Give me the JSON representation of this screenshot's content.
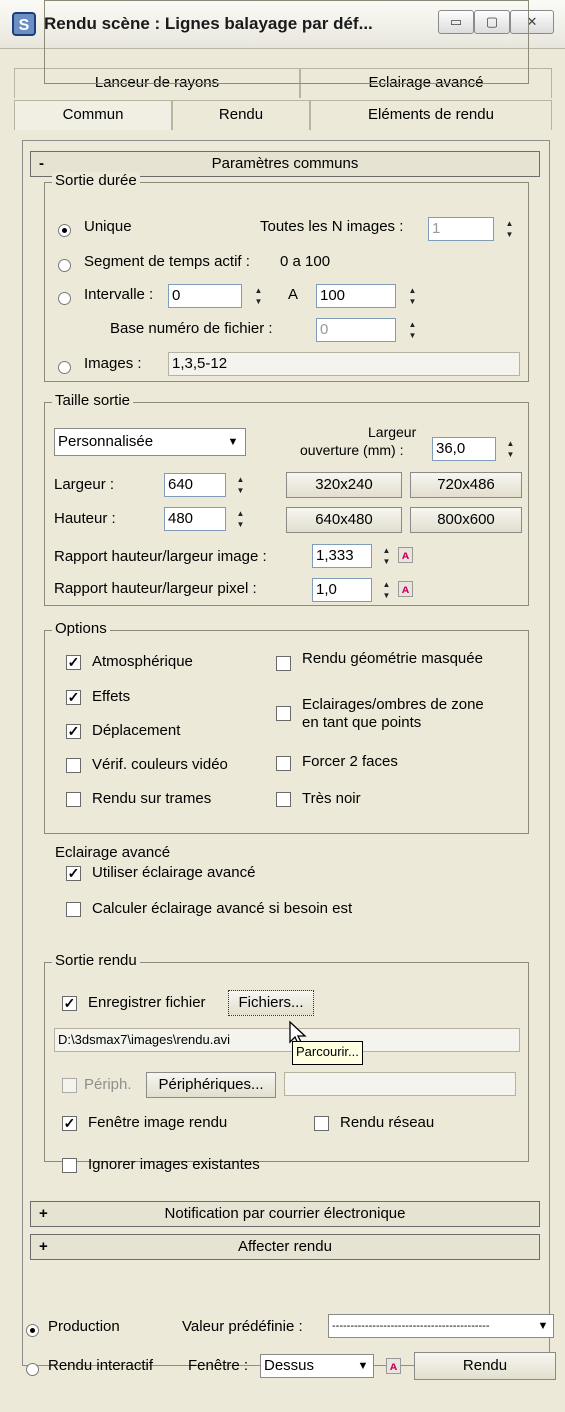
{
  "window": {
    "title": "Rendu scène : Lignes balayage par déf...",
    "icon": "3ds-max-icon",
    "controls": {
      "minimize": "▭",
      "maximize": "▢",
      "close": "✕"
    }
  },
  "tabs": {
    "row1": [
      "Lanceur de rayons",
      "Eclairage avancé"
    ],
    "row2": [
      "Commun",
      "Rendu",
      "Eléments de rendu"
    ]
  },
  "common_params": {
    "rollout_sign": "-",
    "rollout_title": "Paramètres communs",
    "time_output": {
      "title": "Sortie durée",
      "single": "Unique",
      "every_nth_label": "Toutes les N images :",
      "every_nth_value": "1",
      "active_segment_label": "Segment de temps actif :",
      "active_segment_value": "0 a 100",
      "range_label": "Intervalle :",
      "range_from": "0",
      "range_to_label": "A",
      "range_to": "100",
      "file_number_base_label": "Base numéro de fichier :",
      "file_number_base_value": "0",
      "frames_label": "Images :",
      "frames_value": "1,3,5-12"
    },
    "output_size": {
      "title": "Taille sortie",
      "preset": "Personnalisée",
      "aperture_label_1": "Largeur",
      "aperture_label_2": "ouverture (mm) :",
      "aperture_value": "36,0",
      "width_label": "Largeur :",
      "width_value": "640",
      "height_label": "Hauteur :",
      "height_value": "480",
      "presets": [
        "320x240",
        "720x486",
        "640x480",
        "800x600"
      ],
      "image_aspect_label": "Rapport hauteur/largeur image :",
      "image_aspect_value": "1,333",
      "pixel_aspect_label": "Rapport hauteur/largeur pixel :",
      "pixel_aspect_value": "1,0"
    },
    "options": {
      "title": "Options",
      "atmospherics": "Atmosphérique",
      "effects": "Effets",
      "displacement": "Déplacement",
      "video_color_check": "Vérif. couleurs vidéo",
      "render_fields": "Rendu sur trames",
      "render_hidden": "Rendu géométrie masquée",
      "area_lights_1": "Eclairages/ombres de zone",
      "area_lights_2": "en tant que points",
      "force_2_sided": "Forcer 2 faces",
      "super_black": "Très noir"
    },
    "advanced_lighting": {
      "title": "Eclairage avancé",
      "use": "Utiliser éclairage avancé",
      "compute": "Calculer éclairage avancé si besoin est"
    },
    "render_output": {
      "title": "Sortie rendu",
      "save_file": "Enregistrer fichier",
      "files_button": "Fichiers...",
      "file_path": "D:\\3dsmax7\\images\\rendu.avi",
      "tooltip": "Parcourir...",
      "device_label": "Périph.",
      "devices_button": "Périphériques...",
      "frame_window": "Fenêtre image rendu",
      "net_render": "Rendu réseau",
      "skip_existing": "Ignorer images existantes"
    }
  },
  "rollouts": [
    {
      "sign": "+",
      "title": "Notification par courrier électronique"
    },
    {
      "sign": "+",
      "title": "Affecter rendu"
    }
  ],
  "bottom": {
    "production": "Production",
    "preset_label": "Valeur prédéfinie :",
    "preset_value": "-------------------------------------------",
    "activeshade": "Rendu interactif",
    "viewport_label": "Fenêtre :",
    "viewport_value": "Dessus",
    "render_button": "Rendu"
  }
}
